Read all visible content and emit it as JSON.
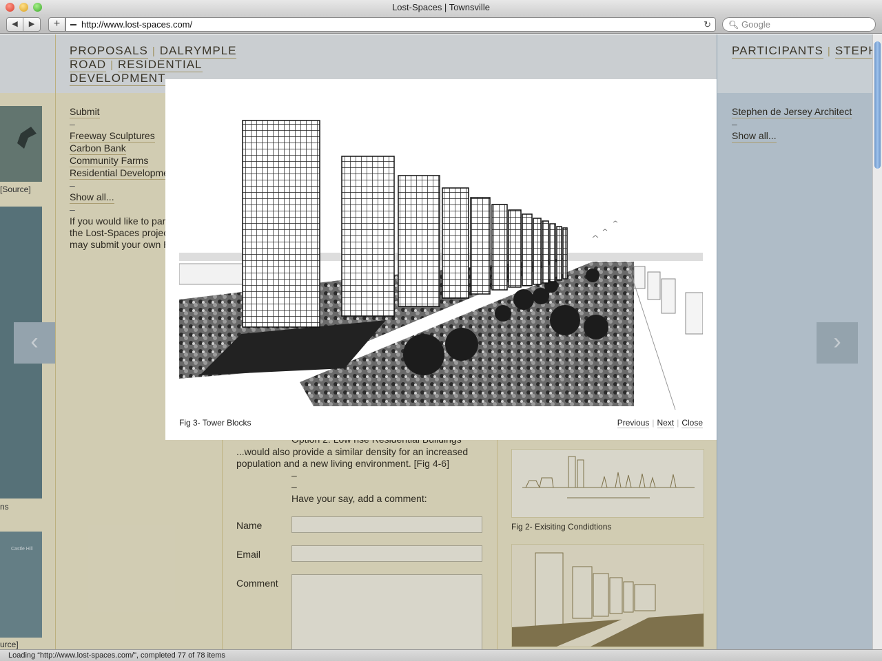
{
  "window": {
    "title": "Lost-Spaces | Townsville"
  },
  "toolbar": {
    "back": "◀",
    "forward": "▶",
    "add": "+",
    "url": "http://www.lost-spaces.com/",
    "search_placeholder": "Google"
  },
  "breadcrumb": {
    "items": [
      "PROPOSALS",
      "DALRYMPLE ROAD",
      "RESIDENTIAL DEVELOPMENT"
    ],
    "sep": "|"
  },
  "participants": {
    "items": [
      "PARTICIPANTS",
      "STEPH"
    ],
    "sep": "|"
  },
  "left_nav": {
    "submit": "Submit",
    "dash": "–",
    "links": [
      "Freeway Sculptures",
      "Carbon Bank",
      "Community Farms",
      "Residential Developme"
    ],
    "show_all": "Show all...",
    "intro": [
      "If you would like to par",
      "the Lost-Spaces projec",
      "may submit your own P"
    ]
  },
  "left_thumbs": {
    "labels": [
      "[Source]",
      "ns",
      "urce]"
    ],
    "thumb_text": "Castle Hill"
  },
  "right_nav": {
    "architect": "Stephen de Jersey Architect",
    "dash": "–",
    "show_all": "Show all..."
  },
  "arrows": {
    "prev": "‹",
    "next": "›"
  },
  "article": {
    "option_cut": "Option 2: Low rise Residential Buildings",
    "para": [
      "...would also provide a similar density for an increased",
      "population and a new living environment. [Fig 4-6]"
    ],
    "dash": "–",
    "comment_heading": "Have your say, add a comment:"
  },
  "form": {
    "name_label": "Name",
    "email_label": "Email",
    "comment_label": "Comment",
    "name_value": "",
    "email_value": "",
    "comment_value": ""
  },
  "figures": {
    "fig2_caption": "Fig 2- Exisiting Condidtions"
  },
  "modal": {
    "caption": "Fig 3- Tower Blocks",
    "previous": "Previous",
    "next": "Next",
    "close": "Close",
    "sep": "|"
  },
  "status": {
    "text": "Loading “http://www.lost-spaces.com/”, completed 77 of 78 items"
  }
}
